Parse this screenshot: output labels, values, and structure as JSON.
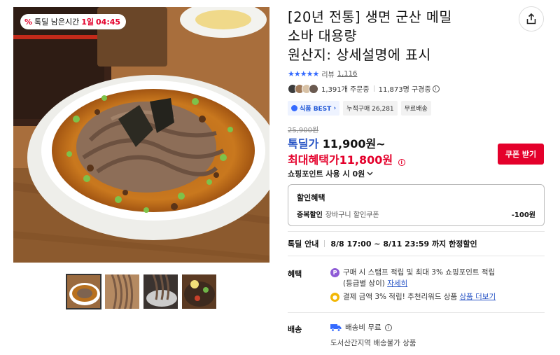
{
  "timer": {
    "label": "톡딜 남은시간",
    "days": "1일",
    "time": "04:45"
  },
  "title": [
    "[20년 전통] 생면 군산 메밀",
    "소바 대용량",
    "원산지: 상세설명에 표시"
  ],
  "rating": {
    "stars": "★★★★★",
    "review_label": "리뷰",
    "review_count": "1,116",
    "accent": "#346aff"
  },
  "buyers": {
    "orders": "1,391개 주문중",
    "watchers": "11,873명 구경중"
  },
  "tags": {
    "best": "식품 BEST",
    "cumulative": "누적구매 26,281",
    "shipping": "무료배송"
  },
  "price": {
    "original": "25,900원",
    "deal_label": "톡딜가",
    "deal_value": "11,900원~",
    "max_label": "최대혜택가",
    "max_value": "11,800원",
    "coupon_button": "쿠폰 받기",
    "points": "쇼핑포인트 사용 시 0원",
    "accent_red": "#e4002b"
  },
  "discount": {
    "heading": "할인혜택",
    "row_label": "중복할인",
    "row_sub": "장바구니 할인쿠폰",
    "row_amount": "-100원"
  },
  "deal_guide": {
    "label": "톡딜 안내",
    "value": "8/8 17:00 ~ 8/11 23:59 까지 한정할인"
  },
  "benefit": {
    "label": "혜택",
    "line1": "구매 시 스탬프 적립 및 최대 3% 쇼핑포인트 적립",
    "line1b": "(등급별 상이)",
    "line1_link": "자세히",
    "line2": "결제 금액 3% 적립! 추천리워드 상품",
    "line2_link": "상품 더보기"
  },
  "delivery": {
    "label": "배송",
    "fee": "배송비 무료",
    "note": "도서산간지역 배송불가 상품"
  }
}
